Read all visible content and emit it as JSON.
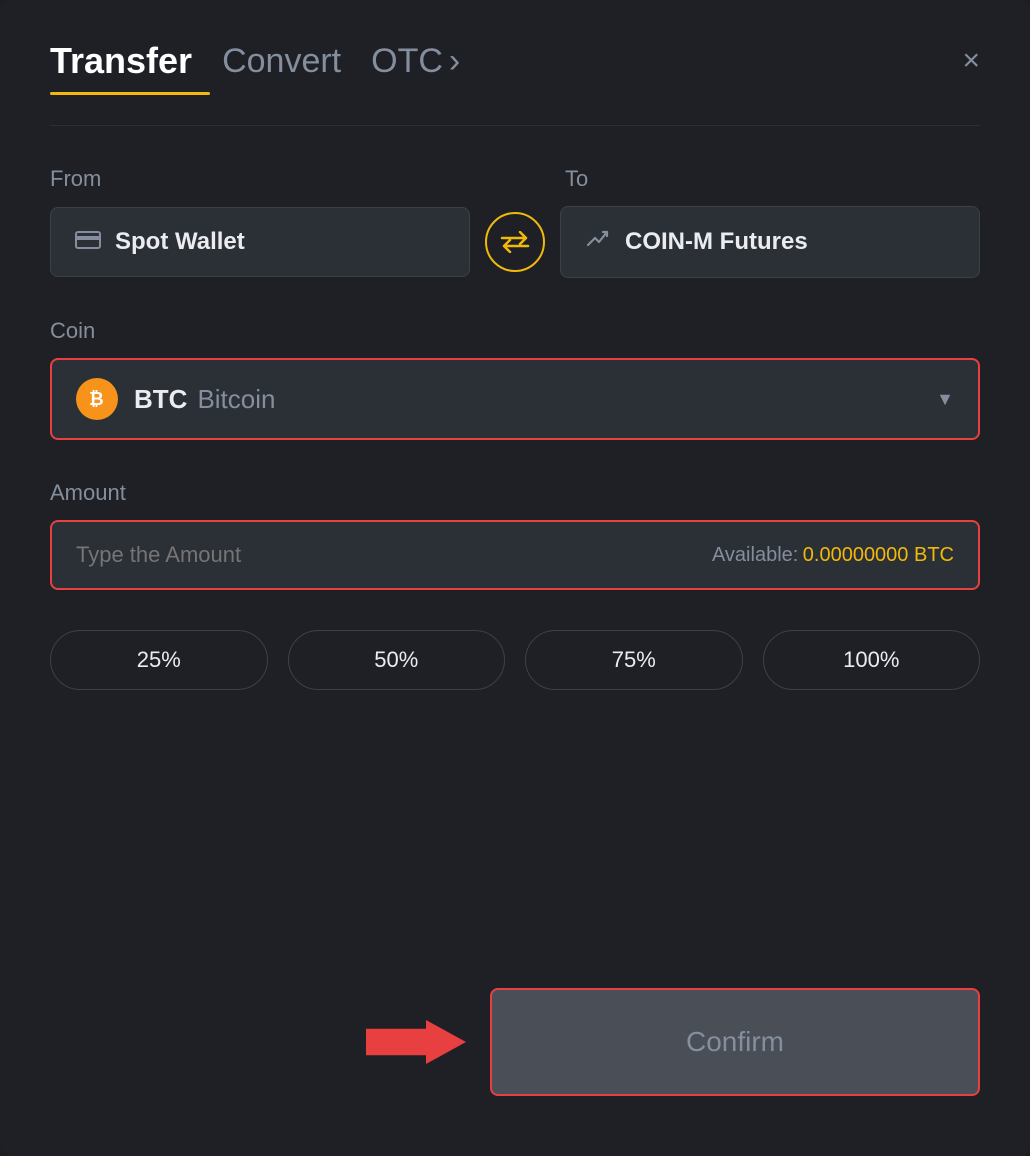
{
  "header": {
    "tab_transfer": "Transfer",
    "tab_convert": "Convert",
    "tab_otc": "OTC",
    "otc_chevron": "›",
    "close_label": "×"
  },
  "from_to": {
    "from_label": "From",
    "to_label": "To",
    "from_wallet": "Spot Wallet",
    "to_wallet": "COIN-M Futures",
    "swap_icon": "⇄"
  },
  "coin": {
    "label": "Coin",
    "symbol": "BTC",
    "name": "Bitcoin",
    "icon_letter": "₿"
  },
  "amount": {
    "label": "Amount",
    "placeholder": "Type the Amount",
    "available_label": "Available:",
    "available_value": "0.00000000 BTC"
  },
  "percentages": [
    {
      "label": "25%"
    },
    {
      "label": "50%"
    },
    {
      "label": "75%"
    },
    {
      "label": "100%"
    }
  ],
  "confirm_button": "Confirm"
}
